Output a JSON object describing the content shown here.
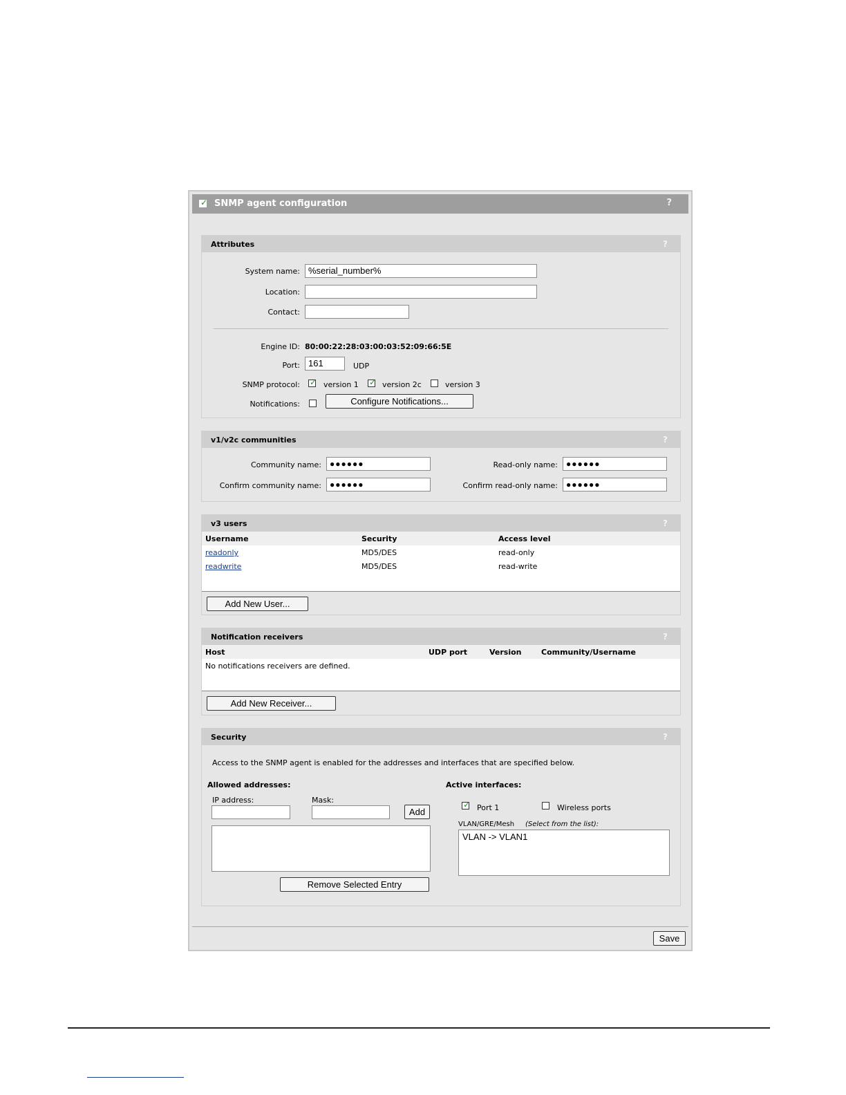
{
  "panel": {
    "title": "SNMP agent configuration",
    "enabled": true,
    "help": "?"
  },
  "attributes": {
    "title": "Attributes",
    "help": "?",
    "system_name_label": "System name:",
    "system_name_value": "%serial_number%",
    "location_label": "Location:",
    "location_value": "",
    "contact_label": "Contact:",
    "contact_value": "",
    "engine_id_label": "Engine ID:",
    "engine_id_value": "80:00:22:28:03:00:03:52:09:66:5E",
    "port_label": "Port:",
    "port_value": "161",
    "port_unit": "UDP",
    "protocol_label": "SNMP protocol:",
    "protocol_options": [
      {
        "label": "version 1",
        "checked": true
      },
      {
        "label": "version 2c",
        "checked": true
      },
      {
        "label": "version 3",
        "checked": false
      }
    ],
    "notifications_label": "Notifications:",
    "notifications_checked": false,
    "configure_notifications_button": "Configure Notifications..."
  },
  "communities": {
    "title": "v1/v2c communities",
    "help": "?",
    "community_name_label": "Community name:",
    "community_name_value": "●●●●●●",
    "confirm_community_label": "Confirm community name:",
    "confirm_community_value": "●●●●●●",
    "readonly_name_label": "Read-only name:",
    "readonly_name_value": "●●●●●●",
    "confirm_readonly_label": "Confirm read-only name:",
    "confirm_readonly_value": "●●●●●●"
  },
  "v3_users": {
    "title": "v3 users",
    "help": "?",
    "columns": [
      "Username",
      "Security",
      "Access level"
    ],
    "rows": [
      {
        "username": "readonly",
        "security": "MD5/DES",
        "access": "read-only"
      },
      {
        "username": "readwrite",
        "security": "MD5/DES",
        "access": "read-write"
      }
    ],
    "add_button": "Add New User..."
  },
  "receivers": {
    "title": "Notification receivers",
    "help": "?",
    "columns": [
      "Host",
      "UDP port",
      "Version",
      "Community/Username"
    ],
    "empty_text": "No notifications receivers are defined.",
    "add_button": "Add New Receiver..."
  },
  "security": {
    "title": "Security",
    "help": "?",
    "intro": "Access to the SNMP agent is enabled for the addresses and interfaces that are specified below.",
    "allowed_label": "Allowed addresses:",
    "ip_label": "IP address:",
    "mask_label": "Mask:",
    "add_button": "Add",
    "remove_button": "Remove Selected Entry",
    "active_label": "Active interfaces:",
    "port1_label": "Port 1",
    "port1_checked": true,
    "wireless_label": "Wireless ports",
    "wireless_checked": false,
    "vlan_label": "VLAN/GRE/Mesh",
    "vlan_hint": "(Select from the list):",
    "vlan_items": [
      "VLAN -> VLAN1"
    ]
  },
  "footer": {
    "save_button": "Save"
  },
  "colors": {
    "panel_bg": "#e6e6e6",
    "header_bg": "#9e9e9e",
    "section_header_bg": "#cfcfcf",
    "link": "#1a3f8f",
    "check": "#2a8a2a"
  }
}
